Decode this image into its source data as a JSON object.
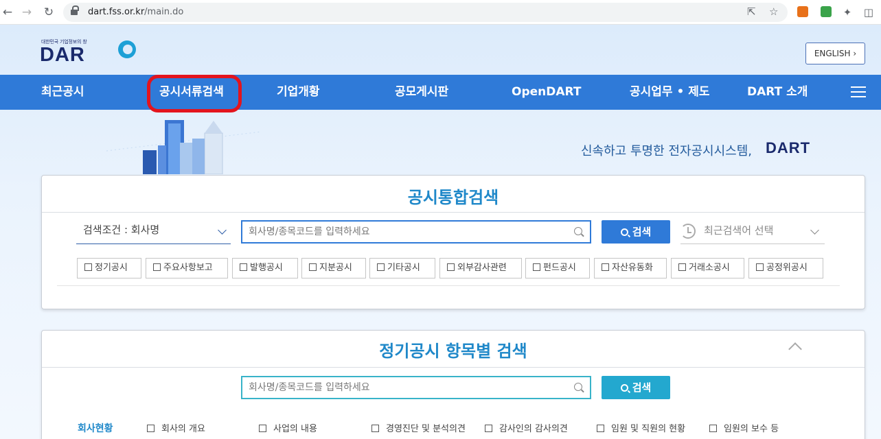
{
  "browser": {
    "url_host": "dart.fss.or.kr",
    "url_path": "/main.do"
  },
  "site": {
    "logo_tagline": "대한민국 기업정보의 창",
    "logo_text": "DAR",
    "english_label": "ENGLISH",
    "english_chevron": "›"
  },
  "nav": {
    "items": [
      "최근공시",
      "공시서류검색",
      "기업개황",
      "공모게시판",
      "OpenDART",
      "공시업무 • 제도",
      "DART 소개"
    ],
    "highlighted_index": 1,
    "highlight_color": "#e3141d",
    "bar_color": "#2f7ad8"
  },
  "hero": {
    "slogan": "신속하고 투명한 전자공시시스템,",
    "slogan_brand": "DART"
  },
  "integrated_search": {
    "title": "공시통합검색",
    "condition_label": "검색조건 : 회사명",
    "input_placeholder": "회사명/종목코드를 입력하세요",
    "search_button": "검색",
    "recent_label": "최근검색어 선택",
    "filters": [
      "정기공시",
      "주요사항보고",
      "발행공시",
      "지분공시",
      "기타공시",
      "외부감사관련",
      "펀드공시",
      "자산유동화",
      "거래소공시",
      "공정위공시"
    ]
  },
  "periodic_search": {
    "title": "정기공시 항목별 검색",
    "input_placeholder": "회사명/종목코드를 입력하세요",
    "search_button": "검색",
    "category_label": "회사현황",
    "items": [
      "회사의 개요",
      "사업의 내용",
      "경영진단 및 분석의견",
      "감사인의 감사의견",
      "임원 및 직원의 현황",
      "임원의 보수 등"
    ]
  }
}
